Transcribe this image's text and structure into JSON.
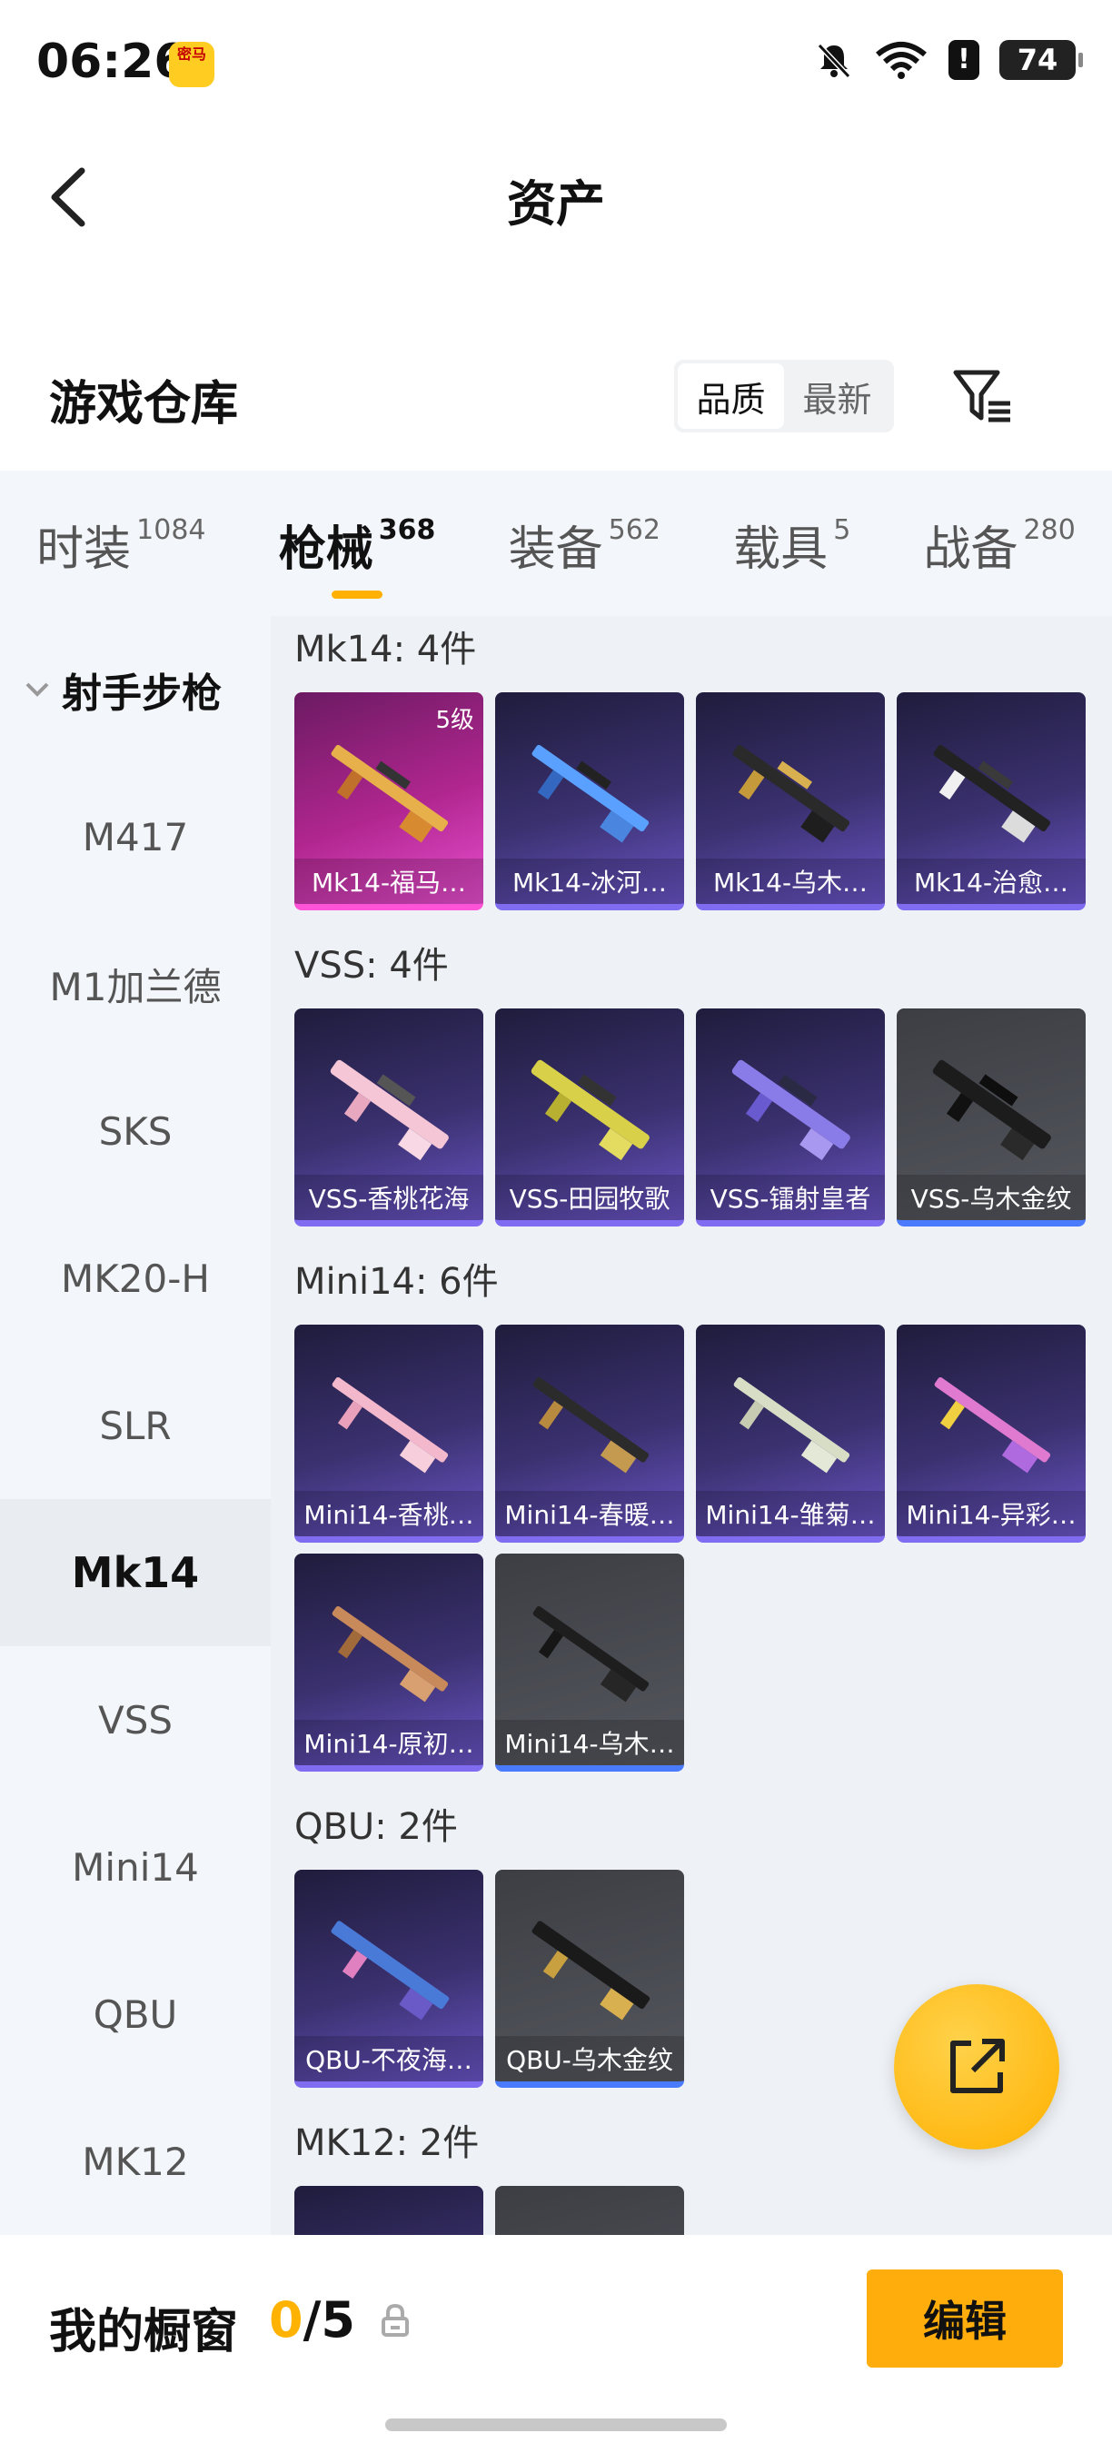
{
  "status_bar": {
    "time": "06:26",
    "app_badge": "密马",
    "battery": "74"
  },
  "header": {
    "title": "资产"
  },
  "section": {
    "title": "游戏仓库",
    "sort_options": [
      "品质",
      "最新"
    ],
    "sort_active": "品质"
  },
  "category_tabs": [
    {
      "label": "时装",
      "count": "1084"
    },
    {
      "label": "枪械",
      "count": "368"
    },
    {
      "label": "装备",
      "count": "562"
    },
    {
      "label": "载具",
      "count": "5"
    },
    {
      "label": "战备",
      "count": "280"
    }
  ],
  "sidebar": {
    "group_label": "射手步枪",
    "items": [
      "M417",
      "M1加兰德",
      "SKS",
      "MK20-H",
      "SLR",
      "Mk14",
      "VSS",
      "Mini14",
      "QBU",
      "MK12"
    ],
    "active_item": "Mk14"
  },
  "groups": [
    {
      "header": "Mk14: 4件",
      "items": [
        {
          "label": "Mk14-福马…",
          "rarity": "pink",
          "level": "5级"
        },
        {
          "label": "Mk14-冰河…",
          "rarity": "purple"
        },
        {
          "label": "Mk14-乌木…",
          "rarity": "purple"
        },
        {
          "label": "Mk14-治愈…",
          "rarity": "purple"
        }
      ]
    },
    {
      "header": "VSS: 4件",
      "items": [
        {
          "label": "VSS-香桃花海",
          "rarity": "purple"
        },
        {
          "label": "VSS-田园牧歌",
          "rarity": "purple"
        },
        {
          "label": "VSS-镭射皇者",
          "rarity": "purple"
        },
        {
          "label": "VSS-乌木金纹",
          "rarity": "grey"
        }
      ]
    },
    {
      "header": "Mini14: 6件",
      "items": [
        {
          "label": "Mini14-香桃…",
          "rarity": "purple"
        },
        {
          "label": "Mini14-春暖…",
          "rarity": "purple"
        },
        {
          "label": "Mini14-雏菊…",
          "rarity": "purple"
        },
        {
          "label": "Mini14-异彩…",
          "rarity": "purple"
        },
        {
          "label": "Mini14-原初…",
          "rarity": "purple"
        },
        {
          "label": "Mini14-乌木…",
          "rarity": "grey"
        }
      ]
    },
    {
      "header": "QBU: 2件",
      "items": [
        {
          "label": "QBU-不夜海…",
          "rarity": "purple"
        },
        {
          "label": "QBU-乌木金纹",
          "rarity": "grey"
        }
      ]
    },
    {
      "header": "MK12: 2件",
      "items": [
        {
          "label": "",
          "rarity": "purple"
        },
        {
          "label": "",
          "rarity": "grey"
        }
      ]
    }
  ],
  "showcase": {
    "label": "我的橱窗",
    "current": "0",
    "separator": "/",
    "max": "5"
  },
  "edit_button": "编辑",
  "icons": {
    "back": "back-arrow-icon",
    "filter": "filter-icon",
    "share": "share-external-icon",
    "lock": "lock-icon",
    "chevron": "chevron-down-icon"
  }
}
